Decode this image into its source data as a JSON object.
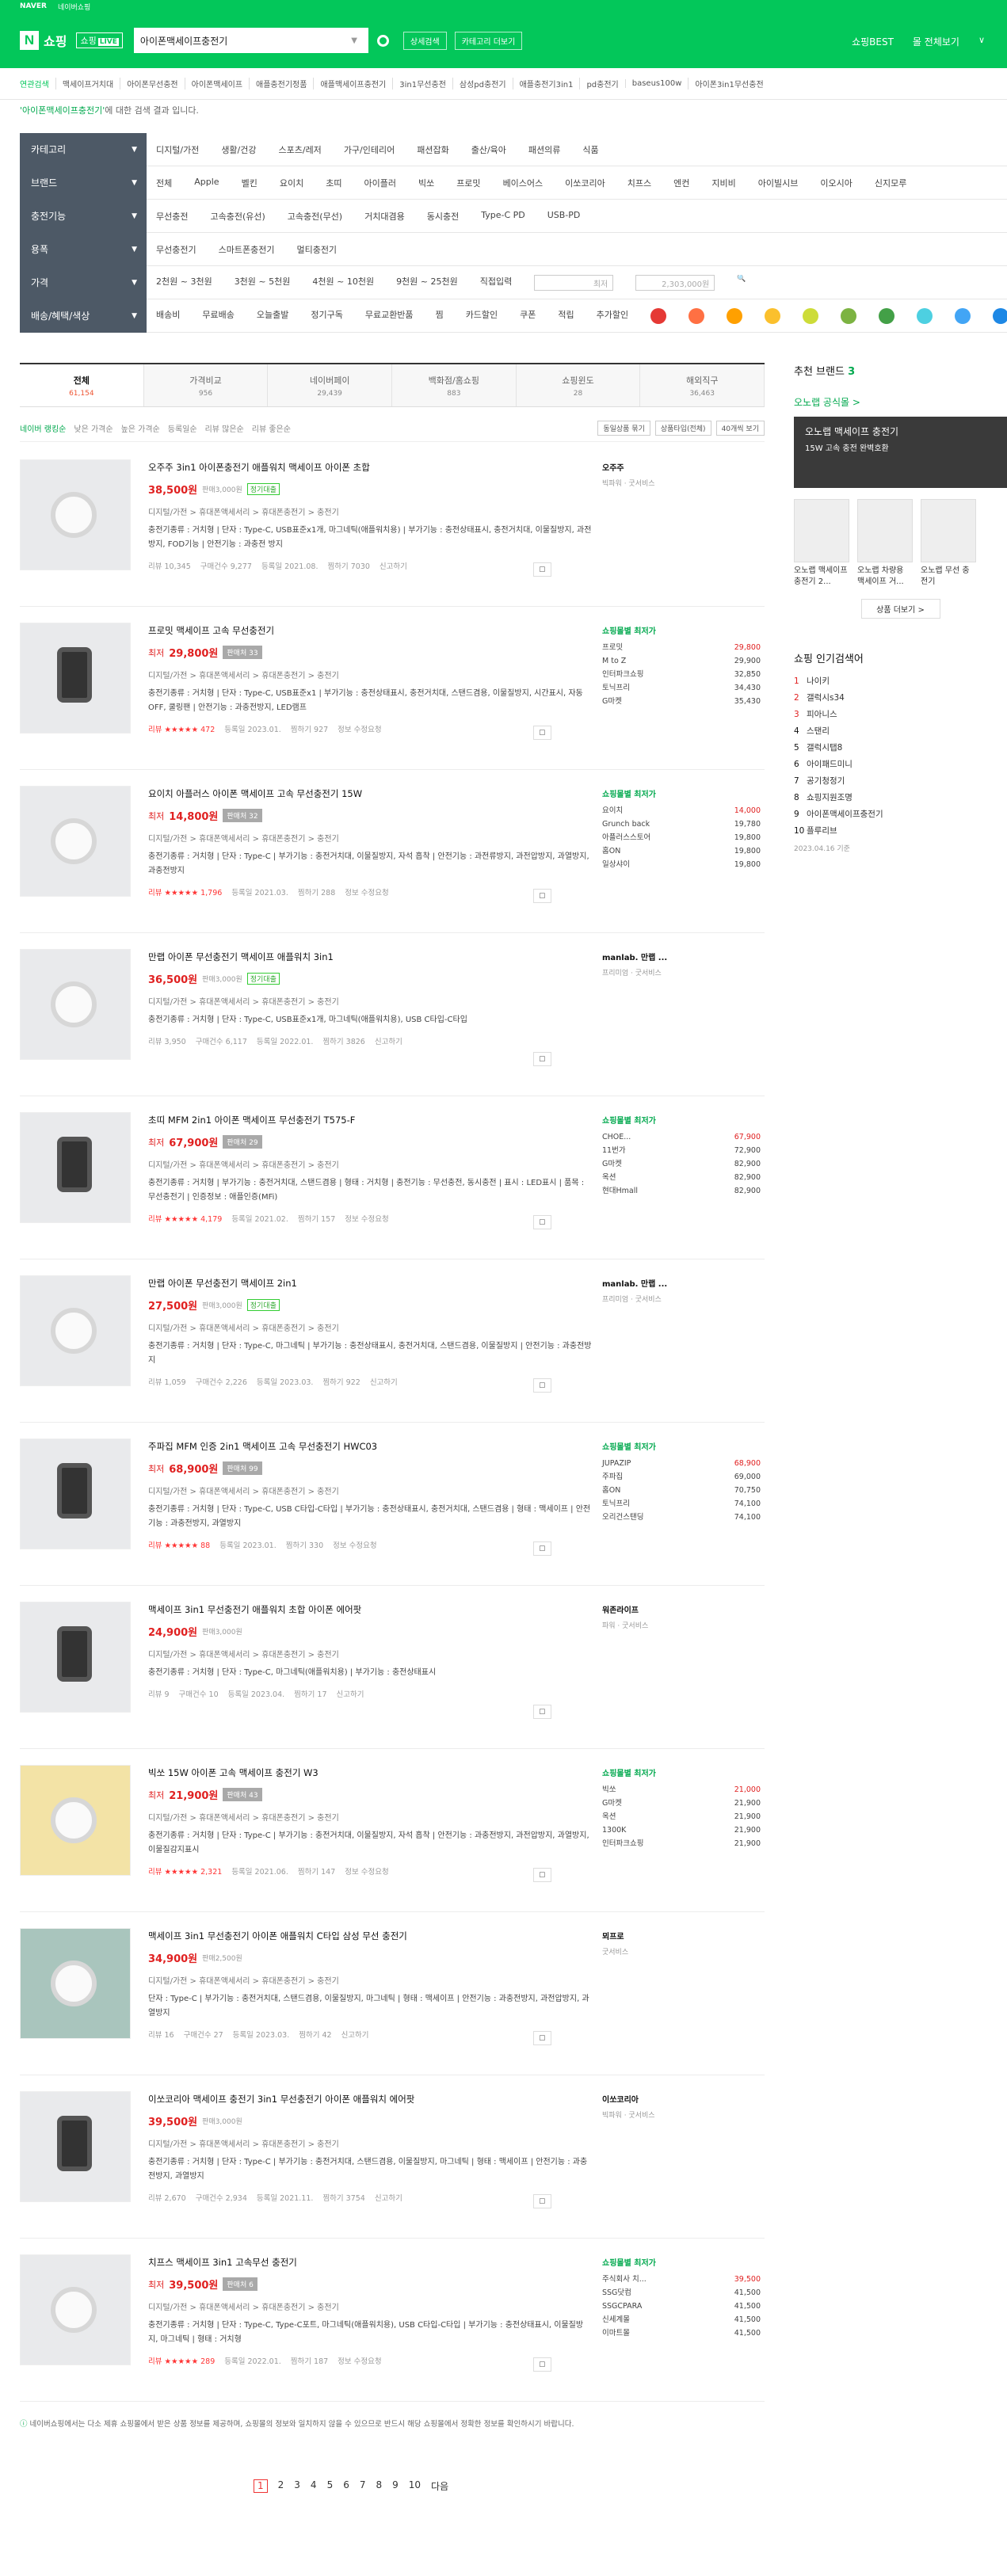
{
  "top": {
    "brand": "NAVER",
    "links": [
      "네이버쇼핑"
    ]
  },
  "header": {
    "logo": "쇼핑",
    "live": "쇼핑",
    "live_tag": "LIVE",
    "query": "아이폰맥세이프충전기",
    "btn_detail": "상세검색",
    "btn_category": "카테고리 더보기",
    "right": [
      "쇼핑BEST",
      "몰 전체보기"
    ],
    "dd": "∨"
  },
  "related": [
    "연관검색",
    "맥세이프거치대",
    "아이폰무선충전",
    "아이폰맥세이프",
    "애플충전기정품",
    "애플맥세이프충전기",
    "3in1무선충전",
    "삼성pd충전기",
    "애플충전기3in1",
    "pd충전기",
    "baseus100w",
    "아이폰3in1무선충전"
  ],
  "notice": {
    "query": "'아이폰맥세이프충전기'",
    "rest": " 에 대한 검색 결과 입니다."
  },
  "filters": [
    {
      "label": "카테고리",
      "items": [
        "디지털/가전",
        "생활/건강",
        "스포츠/레저",
        "가구/인테리어",
        "패션잡화",
        "출산/육아",
        "패션의류",
        "식품"
      ]
    },
    {
      "label": "브랜드",
      "items": [
        "전체",
        "Apple",
        "벨킨",
        "요이치",
        "초띠",
        "아이플러",
        "빅쏘",
        "프로밋",
        "베이스어스",
        "이쏘코리아",
        "치프스",
        "엔컨",
        "지비비",
        "아이빌시브",
        "이오시아",
        "신지모루"
      ]
    },
    {
      "label": "충전기능",
      "items": [
        "무선충전",
        "고속충전(유선)",
        "고속충전(무선)",
        "거치대겸용",
        "동시충전",
        "Type-C PD",
        "USB-PD"
      ]
    },
    {
      "label": "용폭",
      "items": [
        "무선충전기",
        "스마트폰충전기",
        "멀티충전기"
      ]
    },
    {
      "label": "가격",
      "items": [
        "2천원 ~ 3천원",
        "3천원 ~ 5천원",
        "4천원 ~ 10천원",
        "9천원 ~ 25천원",
        "직접입력"
      ],
      "min": "최저",
      "max": "2,303,000원"
    },
    {
      "label": "배송/혜택/색상",
      "items": [
        "배송비",
        "무료배송",
        "오늘출발",
        "정기구독",
        "무료교환반품",
        "찜",
        "카드할인",
        "쿠폰",
        "적립",
        "추가할인"
      ]
    }
  ],
  "colors": [
    "#e53935",
    "#ff7043",
    "#ffa000",
    "#fbc02d",
    "#cddc39",
    "#7cb342",
    "#43a047",
    "#4dd0e1",
    "#42a5f5",
    "#1e88e5",
    "#303f9f",
    "#e0e0e0",
    "#9e9e9e",
    "#424242",
    "#ffffff",
    "#8d6e63",
    "#e91e63",
    "#ab47bc"
  ],
  "tabs": [
    {
      "label": "전체",
      "count": "61,154"
    },
    {
      "label": "가격비교",
      "count": "956"
    },
    {
      "label": "네이버페이",
      "count": "29,439"
    },
    {
      "label": "백화점/홈쇼핑",
      "count": "883"
    },
    {
      "label": "쇼핑윈도",
      "count": "28"
    },
    {
      "label": "해외직구",
      "count": "36,463"
    }
  ],
  "sort": [
    "네이버 랭킹순",
    "낮은 가격순",
    "높은 가격순",
    "등록일순",
    "리뷰 많은순",
    "리뷰 좋은순"
  ],
  "sort_right": [
    "동일상품 묶기",
    "상품타입(전체)",
    "40개씩 보기"
  ],
  "products": [
    {
      "title": "오주주 3in1 아이폰충전기 애플워치 맥세이프 아이폰 초합",
      "plabel": "",
      "price": "38,500원",
      "tag": "판매3,000원",
      "badge": "정기대출",
      "cat": "디지털/가전 > 휴대폰액세서리 > 휴대폰충전기 > 충전기",
      "spec": "충전기종류 : 거치형 | 단자 : Type-C, USB표준x1개, 마그네틱(애플워치용) | 부가기능 : 충전상태표시, 충전거치대, 이물질방지, 과전방지, FOD기능 | 안전기능 : 과충전 방지",
      "meta": [
        "리뷰 10,345",
        "구매건수 9,277",
        "등록일 2021.08.",
        "찜하기 7030",
        "신고하기"
      ],
      "mall": "오주주",
      "malls": [],
      "msub": "빅파워 · 굿서비스",
      "thumb": "plain"
    },
    {
      "title": "프로밋 맥세이프 고속 무선충전기",
      "plabel": "최저",
      "price": "29,800원",
      "tag": "판매처 33",
      "badge": "",
      "cat": "디지털/가전 > 휴대폰액세서리 > 휴대폰충전기 > 충전기",
      "spec": "충전기종류 : 거치형 | 단자 : Type-C, USB표준x1 | 부가기능 : 충전상태표시, 충전거치대, 스탠드겸용, 이물질방지, 시간표시, 자동OFF, 쿨링팬 | 안전기능 : 과충전방지, LED램프",
      "meta": [
        "리뷰 ★★★★★ 472",
        "등록일 2023.01.",
        "찜하기 927",
        "정보 수정요청"
      ],
      "mall": "쇼핑몰별 최저가",
      "malls": [
        [
          "프로밋",
          "29,800"
        ],
        [
          "M to Z",
          "29,900"
        ],
        [
          "인터파크쇼핑",
          "32,850"
        ],
        [
          "토닉프리",
          "34,430"
        ],
        [
          "G마켓",
          "35,430"
        ]
      ],
      "msub": "",
      "thumb": "dark"
    },
    {
      "title": "요이치 아플러스 아이폰 맥세이프 고속 무선충전기 15W",
      "plabel": "최저",
      "price": "14,800원",
      "tag": "판매처 32",
      "badge": "",
      "cat": "디지털/가전 > 휴대폰액세서리 > 휴대폰충전기 > 충전기",
      "spec": "충전기종류 : 거치형 | 단자 : Type-C | 부가기능 : 충전거치대, 이물질방지, 자석 흡착 | 안전기능 : 과전류방지, 과전압방지, 과열방지, 과충전방지",
      "meta": [
        "리뷰 ★★★★★ 1,796",
        "등록일 2021.03.",
        "찜하기 288",
        "정보 수정요청"
      ],
      "mall": "쇼핑몰별 최저가",
      "malls": [
        [
          "요이치",
          "14,000"
        ],
        [
          "Grunch back",
          "19,780"
        ],
        [
          "아플러스스토어",
          "19,800"
        ],
        [
          "홈ON",
          "19,800"
        ],
        [
          "일상샤이",
          "19,800"
        ]
      ],
      "msub": "",
      "thumb": "plain"
    },
    {
      "title": "만랩 아이폰 무선충전기 맥세이프 애플워치 3in1",
      "plabel": "",
      "price": "36,500원",
      "tag": "판매3,000원",
      "badge": "정기대출",
      "cat": "디지털/가전 > 휴대폰액세서리 > 휴대폰충전기 > 충전기",
      "spec": "충전기종류 : 거치형 | 단자 : Type-C, USB표준x1개, 마그네틱(애플워치용), USB C타입-C타입",
      "meta": [
        "리뷰 3,950",
        "구매건수 6,117",
        "등록일 2022.01.",
        "찜하기 3826",
        "신고하기"
      ],
      "mall": "manlab. 만랩 ...",
      "malls": [],
      "msub": "프리미엄 · 굿서비스",
      "thumb": "plain"
    },
    {
      "title": "초띠 MFM 2in1 아이폰 맥세이프 무선충전기 T575-F",
      "plabel": "최저",
      "price": "67,900원",
      "tag": "판매처 29",
      "badge": "",
      "cat": "디지털/가전 > 휴대폰액세서리 > 휴대폰충전기 > 충전기",
      "spec": "충전기종류 : 거치형 | 부가기능 : 충전거치대, 스탠드겸용 | 형태 : 거치형 | 충전기능 : 무선충전, 동시충전 | 표시 : LED표시 | 품목 : 무선충전기 | 인증정보 : 애플인증(MFi)",
      "meta": [
        "리뷰 ★★★★★ 4,179",
        "등록일 2021.02.",
        "찜하기 157",
        "정보 수정요청"
      ],
      "mall": "쇼핑몰별 최저가",
      "malls": [
        [
          "CHOE...",
          "67,900"
        ],
        [
          "11번가",
          "72,900"
        ],
        [
          "G마켓",
          "82,900"
        ],
        [
          "옥션",
          "82,900"
        ],
        [
          "현대Hmall",
          "82,900"
        ]
      ],
      "msub": "",
      "thumb": "dark"
    },
    {
      "title": "만랩 아이폰 무선충전기 맥세이프 2in1",
      "plabel": "",
      "price": "27,500원",
      "tag": "판매3,000원",
      "badge": "정기대출",
      "cat": "디지털/가전 > 휴대폰액세서리 > 휴대폰충전기 > 충전기",
      "spec": "충전기종류 : 거치형 | 단자 : Type-C, 마그네틱 | 부가기능 : 충전상태표시, 충전거치대, 스탠드겸용, 이물질방지 | 안전기능 : 과충전방지",
      "meta": [
        "리뷰 1,059",
        "구매건수 2,226",
        "등록일 2023.03.",
        "찜하기 922",
        "신고하기"
      ],
      "mall": "manlab. 만랩 ...",
      "malls": [],
      "msub": "프리미엄 · 굿서비스",
      "thumb": "plain"
    },
    {
      "title": "주파집 MFM 인증 2in1 맥세이프 고속 무선충전기 HWC03",
      "plabel": "최저",
      "price": "68,900원",
      "tag": "판매처 99",
      "badge": "",
      "cat": "디지털/가전 > 휴대폰액세서리 > 휴대폰충전기 > 충전기",
      "spec": "충전기종류 : 거치형 | 단자 : Type-C, USB C타입-C타입 | 부가기능 : 충전상태표시, 충전거치대, 스탠드겸용 | 형태 : 맥세이프 | 안전기능 : 과충전방지, 과열방지",
      "meta": [
        "리뷰 ★★★★★ 88",
        "등록일 2023.01.",
        "찜하기 330",
        "정보 수정요청"
      ],
      "mall": "쇼핑몰별 최저가",
      "malls": [
        [
          "JUPAZIP",
          "68,900"
        ],
        [
          "주파집",
          "69,000"
        ],
        [
          "홈ON",
          "70,750"
        ],
        [
          "토닉프리",
          "74,100"
        ],
        [
          "오리건스탠딩",
          "74,100"
        ]
      ],
      "msub": "",
      "thumb": "dark"
    },
    {
      "title": "맥세이프 3in1 무선충전기 애플워치 초합 아이폰 에어팟",
      "plabel": "",
      "price": "24,900원",
      "tag": "판매3,000원",
      "badge": "",
      "cat": "디지털/가전 > 휴대폰액세서리 > 휴대폰충전기 > 충전기",
      "spec": "충전기종류 : 거치형 | 단자 : Type-C, 마그네틱(애플워치용) | 부가기능 : 충전상태표시",
      "meta": [
        "리뷰 9",
        "구매건수 10",
        "등록일 2023.04.",
        "찜하기 17",
        "신고하기"
      ],
      "mall": "워존라이프",
      "malls": [],
      "msub": "파워 · 굿서비스",
      "thumb": "dark"
    },
    {
      "title": "빅쏘 15W 아이폰 고속 맥세이프 충전기 W3",
      "plabel": "최저",
      "price": "21,900원",
      "tag": "판매처 43",
      "badge": "",
      "cat": "디지털/가전 > 휴대폰액세서리 > 휴대폰충전기 > 충전기",
      "spec": "충전기종류 : 거치형 | 단자 : Type-C | 부가기능 : 충전거치대, 이물질방지, 자석 흡착 | 안전기능 : 과충전방지, 과전압방지, 과열방지, 이물질감지표시",
      "meta": [
        "리뷰 ★★★★★ 2,321",
        "등록일 2021.06.",
        "찜하기 147",
        "정보 수정요청"
      ],
      "mall": "쇼핑몰별 최저가",
      "malls": [
        [
          "빅쏘",
          "21,000"
        ],
        [
          "G마켓",
          "21,900"
        ],
        [
          "옥션",
          "21,900"
        ],
        [
          "1300K",
          "21,900"
        ],
        [
          "인터파크쇼핑",
          "21,900"
        ]
      ],
      "msub": "",
      "thumb": "yellow"
    },
    {
      "title": "맥세이프 3in1 무선충전기 아이폰 애플워치 C타입 삼성 무선 충전기",
      "plabel": "",
      "price": "34,900원",
      "tag": "판매2,500원",
      "badge": "",
      "cat": "디지털/가전 > 휴대폰액세서리 > 휴대폰충전기 > 충전기",
      "spec": "단자 : Type-C | 부가기능 : 충전거치대, 스탠드겸용, 이물질방지, 마그네틱 | 형태 : 맥세이프 | 안전기능 : 과충전방지, 과전압방지, 과열방지",
      "meta": [
        "리뷰 16",
        "구매건수 27",
        "등록일 2023.03.",
        "찜하기 42",
        "신고하기"
      ],
      "mall": "뫼프로",
      "malls": [],
      "msub": "굿서비스",
      "thumb": "teal"
    },
    {
      "title": "이쏘코리아 맥세이프 충전기 3in1 무선충전기 아이폰 애플워치 에어팟",
      "plabel": "",
      "price": "39,500원",
      "tag": "판매3,000원",
      "badge": "",
      "cat": "디지털/가전 > 휴대폰액세서리 > 휴대폰충전기 > 충전기",
      "spec": "충전기종류 : 거치형 | 단자 : Type-C | 부가기능 : 충전거치대, 스탠드겸용, 이물질방지, 마그네틱 | 형태 : 맥세이프 | 안전기능 : 과충전방지, 과열방지",
      "meta": [
        "리뷰 2,670",
        "구매건수 2,934",
        "등록일 2021.11.",
        "찜하기 3754",
        "신고하기"
      ],
      "mall": "이쏘코리아",
      "malls": [],
      "msub": "빅파워 · 굿서비스",
      "thumb": "dark"
    },
    {
      "title": "치프스 맥세이프 3in1 고속무선 충전기",
      "plabel": "최저",
      "price": "39,500원",
      "tag": "판매처 6",
      "badge": "",
      "cat": "디지털/가전 > 휴대폰액세서리 > 휴대폰충전기 > 충전기",
      "spec": "충전기종류 : 거치형 | 단자 : Type-C, Type-C포트, 마그네틱(애플워치용), USB C타입-C타입 | 부가기능 : 충전상태표시, 이물질방지, 마그네틱 | 형태 : 거치형",
      "meta": [
        "리뷰 ★★★★★ 289",
        "등록일 2022.01.",
        "찜하기 187",
        "정보 수정요청"
      ],
      "mall": "쇼핑몰별 최저가",
      "malls": [
        [
          "주식회사 치...",
          "39,500"
        ],
        [
          "SSG닷컴",
          "41,500"
        ],
        [
          "SSGCPARA",
          "41,500"
        ],
        [
          "신세계몰",
          "41,500"
        ],
        [
          "이마트몰",
          "41,500"
        ]
      ],
      "msub": "",
      "thumb": "plain"
    }
  ],
  "footnote": "네이버쇼핑에서는 다소 제휴 쇼핑몰에서 받은 상품 정보를 제공하며, 쇼핑몰의 정보와 일치하지 않을 수 있으므로 반드시 해당 쇼핑몰에서 정확한 정보를 확인하시기 바랍니다.",
  "pages": [
    "1",
    "2",
    "3",
    "4",
    "5",
    "6",
    "7",
    "8",
    "9",
    "10",
    "다음"
  ],
  "side": {
    "title": "추천 브랜드",
    "title_num": "3",
    "brand": "오노랩 공식몰 >",
    "banner_title": "오노랩 맥세이프 충전기",
    "banner_sub": "15W 고속 충전 완벽호환",
    "brand_products": [
      "오노랩 맥세이프 충전기 2...",
      "오노랩 차량용 맥세이프 거...",
      "오노랩 무선 충전기"
    ],
    "more": "상품 더보기 >",
    "pop_title": "쇼핑 인기검색어",
    "popular": [
      "나이키",
      "갤럭시s34",
      "피아니스",
      "스탠리",
      "갤럭시탭8",
      "아이패드미니",
      "공기청정기",
      "쇼핑지원조명",
      "아이폰맥세이프충전기",
      "플루리브"
    ],
    "pop_date": "2023.04.16 기준"
  }
}
